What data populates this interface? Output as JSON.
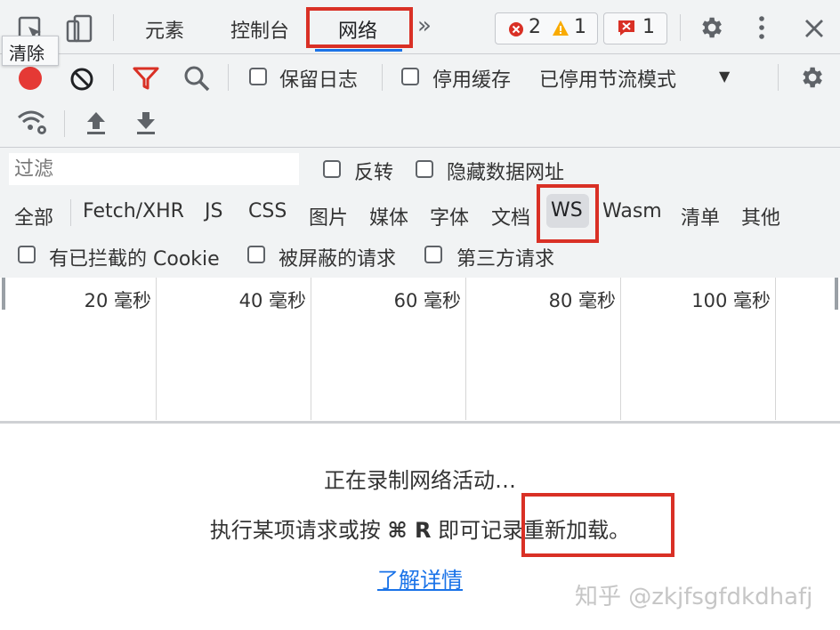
{
  "tabs": {
    "elements": "元素",
    "console": "控制台",
    "network": "网络",
    "more": "»"
  },
  "badges": {
    "errors": "2",
    "warnings": "1",
    "issues": "1"
  },
  "tooltip": {
    "clear": "清除"
  },
  "toolbar": {
    "preserve_log": "保留日志",
    "disable_cache": "停用缓存",
    "throttling": "已停用节流模式",
    "throttling_arrow": "▼"
  },
  "filter": {
    "placeholder": "过滤",
    "invert": "反转",
    "hide_data_urls": "隐藏数据网址"
  },
  "type_filters": [
    "全部",
    "Fetch/XHR",
    "JS",
    "CSS",
    "图片",
    "媒体",
    "字体",
    "文档",
    "WS",
    "Wasm",
    "清单",
    "其他"
  ],
  "extra_filters": {
    "blocked_cookies": "有已拦截的 Cookie",
    "blocked_requests": "被屏蔽的请求",
    "third_party": "第三方请求"
  },
  "timeline": {
    "ticks": [
      "20 毫秒",
      "40 毫秒",
      "60 毫秒",
      "80 毫秒",
      "100 毫秒"
    ]
  },
  "empty_state": {
    "line1": "正在录制网络活动…",
    "line2_prefix": "执行某项请求或按 ",
    "shortcut": "⌘ R",
    "line2_suffix": " 即可记录重新加载。",
    "learn_more": "了解详情"
  },
  "watermark": "知乎 @zkjfsgfdkdhafj",
  "colors": {
    "record": "#e53935",
    "highlight": "#d93025",
    "link": "#1a73e8"
  }
}
